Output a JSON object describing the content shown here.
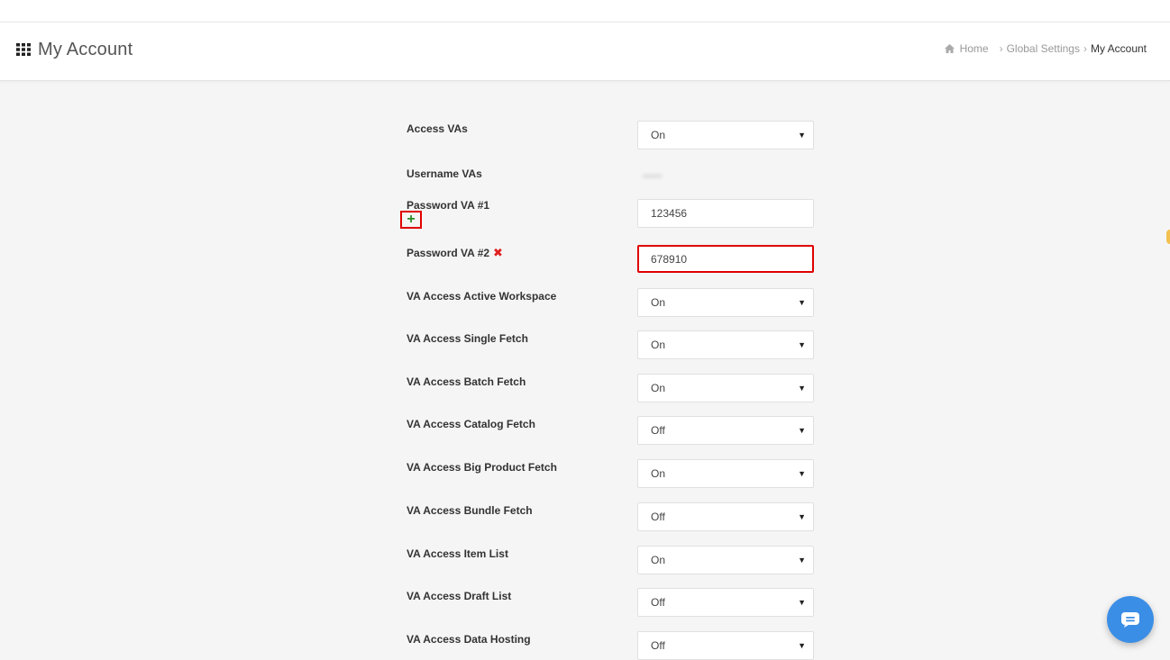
{
  "header": {
    "title": "My Account",
    "grid_icon": "grid-icon"
  },
  "breadcrumb": {
    "home": "Home",
    "separator": "›",
    "global_settings": "Global Settings",
    "current": "My Account",
    "home_icon": "home-icon"
  },
  "form": {
    "access_vas": {
      "label": "Access VAs",
      "value": "On"
    },
    "username_vas": {
      "label": "Username VAs",
      "value": "••••••"
    },
    "password_va1": {
      "label": "Password VA #1",
      "value": "123456",
      "add_icon": "plus-icon"
    },
    "password_va2": {
      "label": "Password VA #2",
      "value": "678910",
      "remove_icon": "x-icon"
    },
    "active_workspace": {
      "label": "VA Access Active Workspace",
      "value": "On"
    },
    "single_fetch": {
      "label": "VA Access Single Fetch",
      "value": "On"
    },
    "batch_fetch": {
      "label": "VA Access Batch Fetch",
      "value": "On"
    },
    "catalog_fetch": {
      "label": "VA Access Catalog Fetch",
      "value": "Off"
    },
    "big_product_fetch": {
      "label": "VA Access Big Product Fetch",
      "value": "On"
    },
    "bundle_fetch": {
      "label": "VA Access Bundle Fetch",
      "value": "Off"
    },
    "item_list": {
      "label": "VA Access Item List",
      "value": "On"
    },
    "draft_list": {
      "label": "VA Access Draft List",
      "value": "Off"
    },
    "data_hosting": {
      "label": "VA Access Data Hosting",
      "value": "Off"
    }
  },
  "colors": {
    "accent_red": "#e00000",
    "add_green": "#2b8a2b",
    "chat_blue": "#3b8ee6"
  },
  "chat": {
    "icon": "chat-icon"
  }
}
